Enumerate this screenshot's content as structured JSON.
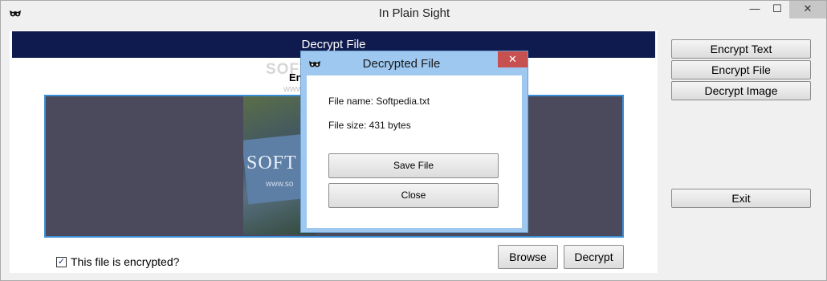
{
  "window": {
    "title": "In Plain Sight",
    "minimize_glyph": "—",
    "maximize_glyph": "☐",
    "close_glyph": "✕"
  },
  "main": {
    "banner_title": "Decrypt File",
    "hidden_label_fragment": "En",
    "image": {
      "sign_text": "SOFT",
      "sign_subtext": "www.so"
    },
    "encrypted_checkbox": {
      "label": "This file is encrypted?",
      "checked": true,
      "check_glyph": "✓"
    },
    "browse_label": "Browse",
    "decrypt_label": "Decrypt"
  },
  "sidebar": {
    "items": [
      {
        "label": "Encrypt Text"
      },
      {
        "label": "Encrypt File"
      },
      {
        "label": "Decrypt Image"
      },
      {
        "label": "Exit"
      }
    ]
  },
  "watermark": {
    "text": "SOFTPEDIA",
    "sub": "www.softpedia.com"
  },
  "dialog": {
    "title": "Decrypted File",
    "close_glyph": "✕",
    "file_name": "File name: Softpedia.txt",
    "file_size": "File size: 431 bytes",
    "save_label": "Save File",
    "close_label": "Close"
  },
  "colors": {
    "banner": "#0f1b4e",
    "dialog_frame": "#9ec8ef",
    "dialog_close": "#c75050",
    "image_border": "#3c8fd6"
  }
}
